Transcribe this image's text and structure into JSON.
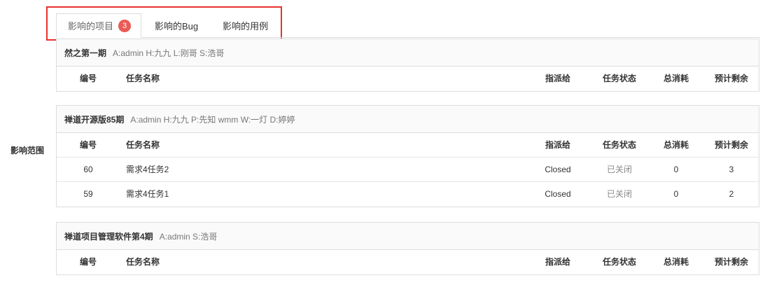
{
  "tabs": [
    {
      "label": "影响的项目",
      "badge": "3"
    },
    {
      "label": "影响的Bug"
    },
    {
      "label": "影响的用例"
    }
  ],
  "range_label": "影响范围",
  "columns": {
    "id": "编号",
    "name": "任务名称",
    "assigned": "指派给",
    "status": "任务状态",
    "consumed": "总消耗",
    "left": "预计剩余"
  },
  "projects": [
    {
      "name": "然之第一期",
      "meta": "A:admin H:九九 L:刚哥 S:浩哥",
      "rows": []
    },
    {
      "name": "禅道开源版85期",
      "meta": "A:admin H:九九 P:先知 wmm W:一灯 D:婷婷",
      "rows": [
        {
          "id": "60",
          "name": "需求4任务2",
          "assigned": "Closed",
          "status": "已关闭",
          "consumed": "0",
          "left": "3"
        },
        {
          "id": "59",
          "name": "需求4任务1",
          "assigned": "Closed",
          "status": "已关闭",
          "consumed": "0",
          "left": "2"
        }
      ]
    },
    {
      "name": "禅道项目管理软件第4期",
      "meta": "A:admin S:浩哥",
      "rows": []
    }
  ],
  "colors": {
    "highlight": "#e8312f",
    "badge": "#ea5b55",
    "border": "#dddddd"
  }
}
